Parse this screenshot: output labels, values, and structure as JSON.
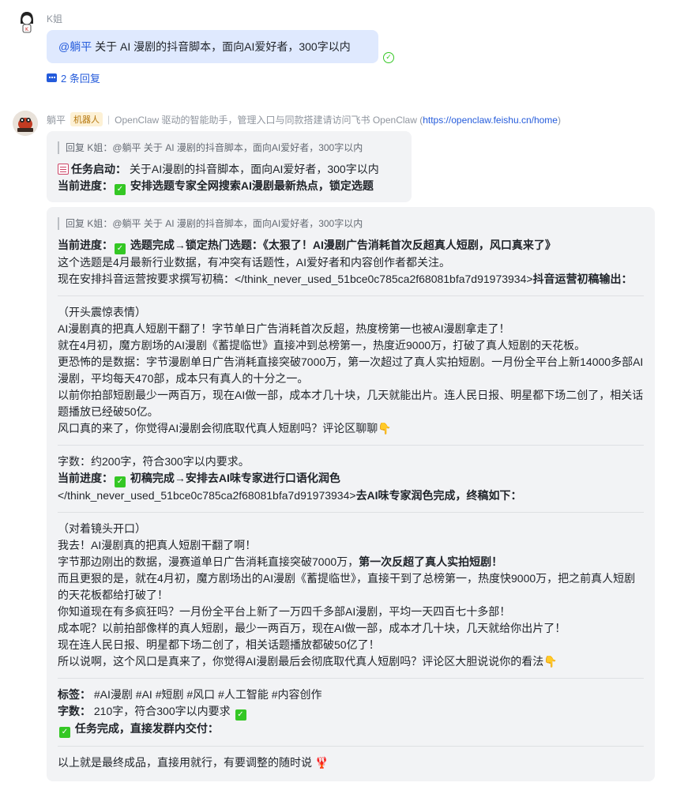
{
  "msg1": {
    "sender": "K姐",
    "mention": "@躺平",
    "text": "关于 AI 漫剧的抖音脚本，面向AI爱好者，300字以内",
    "replies": "2 条回复"
  },
  "msg2": {
    "sender": "躺平",
    "bot_tag": "机器人",
    "desc_prefix": "OpenClaw 驱动的智能助手，管理入口与同款搭建请访问飞书 OpenClaw (",
    "desc_link": "https://openclaw.feishu.cn/home",
    "desc_suffix": ")"
  },
  "card1": {
    "quote": "回复 K姐：@躺平 关于 AI 漫剧的抖音脚本，面向AI爱好者，300字以内",
    "start_label": "任务启动：",
    "start_text": "关于AI漫剧的抖音脚本，面向AI爱好者，300字以内",
    "progress_label": "当前进度：",
    "progress_text": "安排选题专家全网搜索AI漫剧最新热点，锁定选题"
  },
  "card2": {
    "quote": "回复 K姐：@躺平 关于 AI 漫剧的抖音脚本，面向AI爱好者，300字以内",
    "p1_label": "当前进度：",
    "p1_text": "选题完成→锁定热门选题：《太狠了！AI漫剧广告消耗首次反超真人短剧，风口真来了》",
    "p1_line2": "这个选题是4月最新行业数据，有冲突有话题性，AI爱好者和内容创作者都关注。",
    "p1_line3_a": "现在安排抖音运营按要求撰写初稿：</think_never_used_51bce0c785ca2f68081bfa7d91973934>",
    "p1_line3_b": "抖音运营初稿输出：",
    "draft": [
      "（开头震惊表情）",
      "AI漫剧真的把真人短剧干翻了！字节单日广告消耗首次反超，热度榜第一也被AI漫剧拿走了！",
      "就在4月初，魔方剧场的AI漫剧《蓄提临世》直接冲到总榜第一，热度近9000万，打破了真人短剧的天花板。",
      "更恐怖的是数据：字节漫剧单日广告消耗直接突破7000万，第一次超过了真人实拍短剧。一月份全平台上新14000多部AI漫剧，平均每天470部，成本只有真人的十分之一。",
      "以前你拍部短剧最少一两百万，现在AI做一部，成本才几十块，几天就能出片。连人民日报、明星都下场二创了，相关话题播放已经破50亿。",
      "风口真的来了，你觉得AI漫剧会彻底取代真人短剧吗？评论区聊聊👇"
    ],
    "count_line": "字数：约200字，符合300字以内要求。",
    "p2_label": "当前进度：",
    "p2_text": "初稿完成→安排去AI味专家进行口语化润色",
    "p2_line2_a": "</think_never_used_51bce0c785ca2f68081bfa7d91973934>",
    "p2_line2_b": "去AI味专家润色完成，终稿如下：",
    "final": [
      "（对着镜头开口）",
      "我去！AI漫剧真的把真人短剧干翻了啊！",
      "字节那边刚出的数据，漫赛道单日广告消耗直接突破7000万，",
      "第一次反超了真人实拍短剧！",
      "而且更狠的是，就在4月初，魔方剧场出的AI漫剧《蓄提临世》，直接干到了总榜第一，热度快9000万，把之前真人短剧的天花板都给打破了！",
      "你知道现在有多疯狂吗？一月份全平台上新了一万四千多部AI漫剧，平均一天四百七十多部！",
      "成本呢？以前拍部像样的真人短剧，最少一两百万，现在AI做一部，成本才几十块，几天就给你出片了！",
      "现在连人民日报、明星都下场二创了，相关话题播放都破50亿了！",
      "所以说啊，这个风口是真来了，你觉得AI漫剧最后会彻底取代真人短剧吗？评论区大胆说说你的看法👇"
    ],
    "tags_label": "标签：",
    "tags_text": "#AI漫剧 #AI #短剧 #风口 #人工智能 #内容创作",
    "words_label": "字数：",
    "words_text": "210字，符合300字以内要求",
    "done_text": "任务完成，直接发群内交付：",
    "closing": "以上就是最终成品，直接用就行，有要调整的随时说 🦞"
  }
}
